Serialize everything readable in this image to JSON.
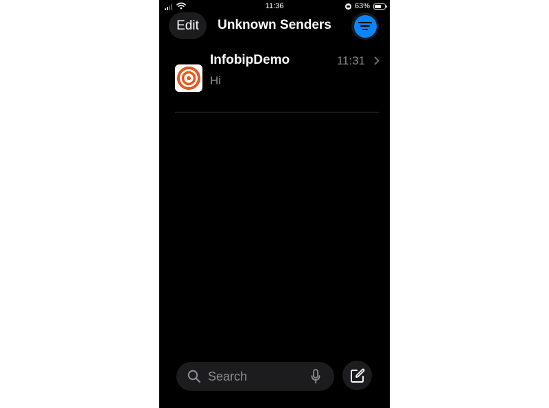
{
  "status_bar": {
    "time": "11:36",
    "battery_percent": "63%",
    "battery_level": 0.63
  },
  "nav": {
    "edit_label": "Edit",
    "title": "Unknown Senders",
    "filter_icon": "filter-lines-icon",
    "accent_color": "#0a84ff"
  },
  "messages": [
    {
      "sender": "InfobipDemo",
      "time": "11:31",
      "preview": "Hi",
      "avatar_color": "#e8581c"
    }
  ],
  "search": {
    "placeholder": "Search"
  },
  "icons": {
    "search": "search-icon",
    "mic": "microphone-icon",
    "compose": "compose-icon",
    "chevron": "chevron-right-icon"
  }
}
